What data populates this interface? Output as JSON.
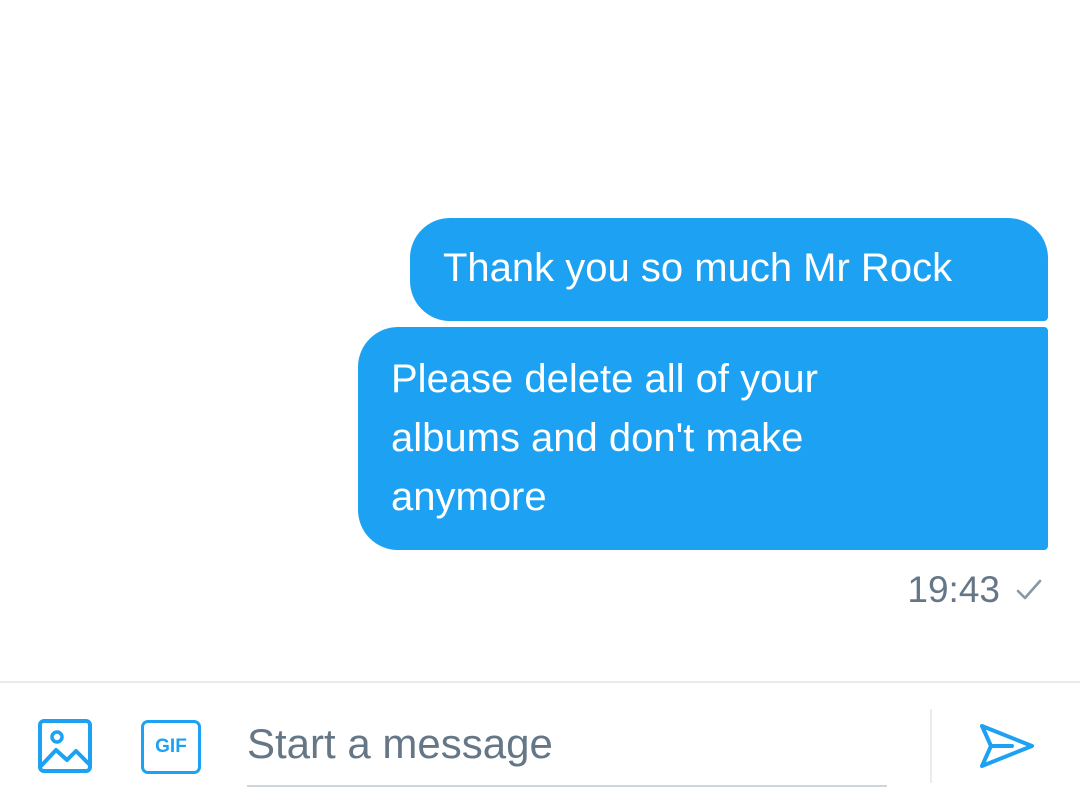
{
  "conversation": {
    "messages": [
      {
        "text": "Thank you so much Mr Rock",
        "direction": "outgoing"
      },
      {
        "text": "Please delete all of your albums and don't make anymore",
        "direction": "outgoing"
      }
    ],
    "timestamp": "19:43",
    "status_icon": "check-icon"
  },
  "composer": {
    "placeholder": "Start a message",
    "value": "",
    "media_icon": "image-icon",
    "gif_label": "GIF",
    "send_icon": "send-icon"
  },
  "colors": {
    "accent": "#1da1f2",
    "bubble_text": "#ffffff",
    "meta_text": "#657786",
    "divider": "#e6ecf0"
  }
}
